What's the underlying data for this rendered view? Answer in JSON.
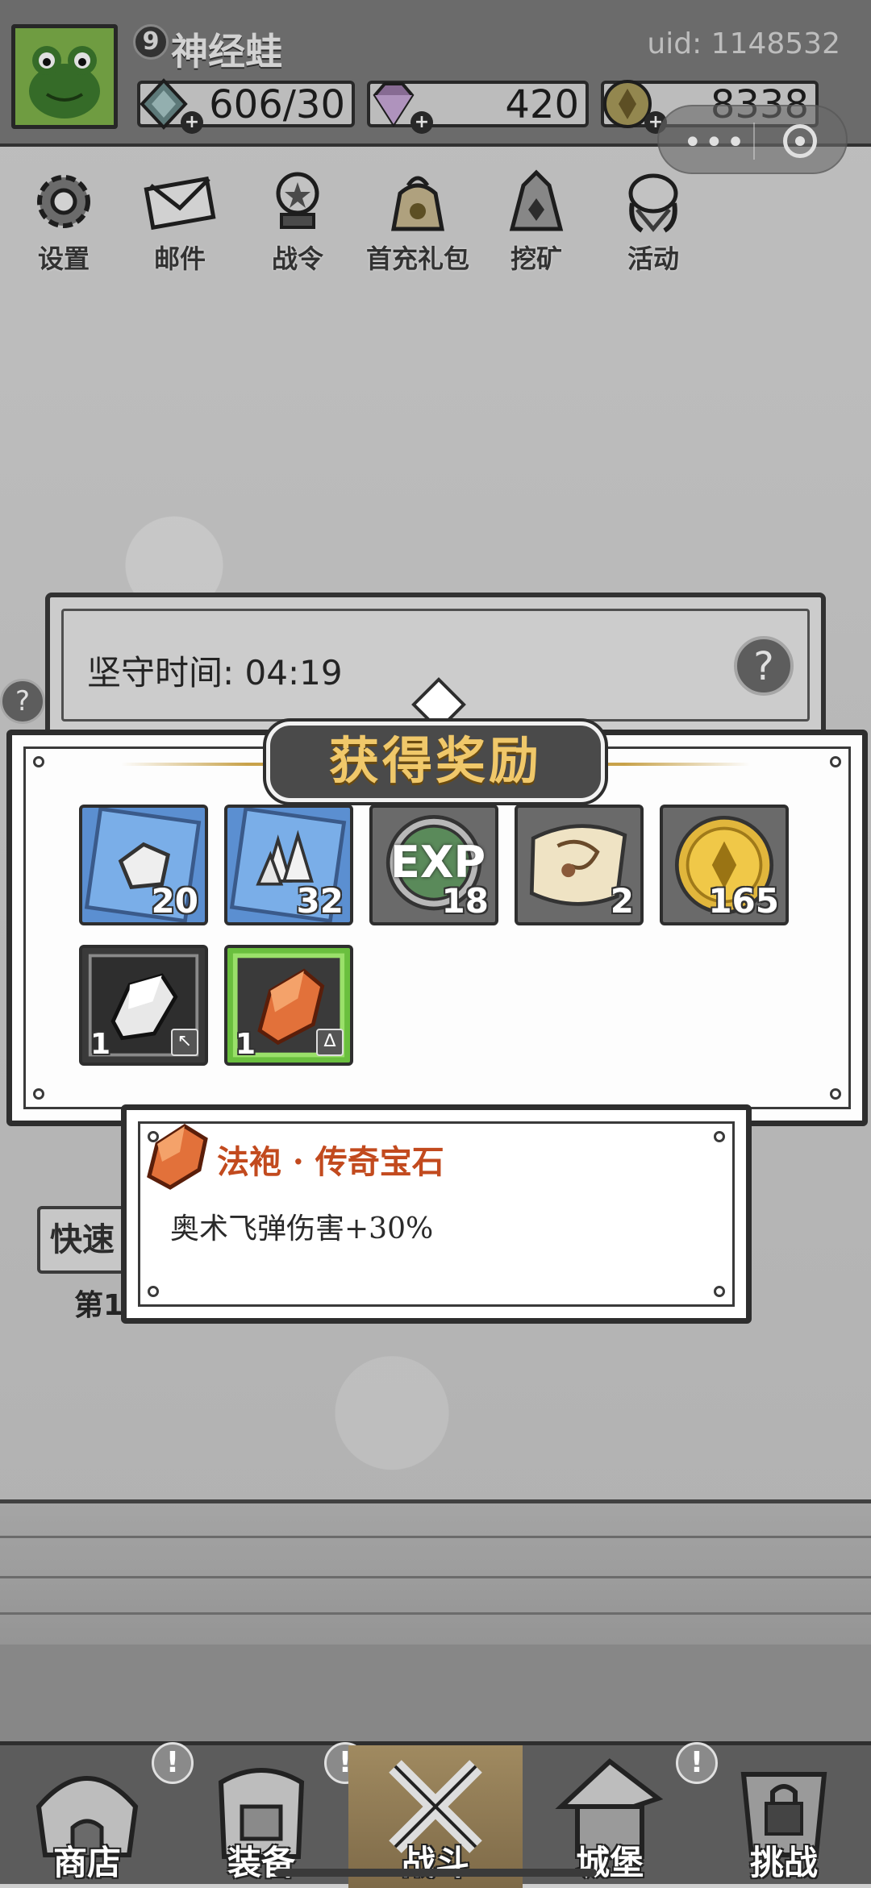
{
  "player": {
    "level": "9",
    "name": "神经蛙",
    "uid": "uid: 1148532"
  },
  "resources": {
    "stamina": "606/30",
    "diamonds": "420",
    "gold": "8338"
  },
  "menu": [
    {
      "label": "设置",
      "icon": "gear-icon"
    },
    {
      "label": "邮件",
      "icon": "mail-icon"
    },
    {
      "label": "战令",
      "icon": "battle-pass-icon"
    },
    {
      "label": "首充礼包",
      "icon": "gift-bag-icon"
    },
    {
      "label": "挖矿",
      "icon": "mining-icon"
    },
    {
      "label": "活动",
      "icon": "event-icon"
    }
  ],
  "defend": {
    "label": "坚守时间: 04:19",
    "help": "?"
  },
  "reward": {
    "title": "获得奖励",
    "items": [
      {
        "name": "iron-ore",
        "count": "20",
        "color": "#5b8fd1"
      },
      {
        "name": "crystal",
        "count": "32",
        "color": "#5b8fd1"
      },
      {
        "name": "exp",
        "count": "18",
        "label": "EXP"
      },
      {
        "name": "scroll",
        "count": "2"
      },
      {
        "name": "gold-coin",
        "count": "165"
      },
      {
        "name": "silver-gem",
        "count": "1"
      },
      {
        "name": "legendary-gem",
        "count": "1",
        "color": "#6abf3e"
      }
    ]
  },
  "tooltip": {
    "title": "法袍 · 传奇宝石",
    "desc": "奥术飞弹伤害+30%"
  },
  "background": {
    "quick_label": "快速",
    "stage_label": "第1"
  },
  "nav": [
    {
      "label": "商店",
      "alert": "!"
    },
    {
      "label": "装备",
      "alert": "!"
    },
    {
      "label": "战斗"
    },
    {
      "label": "城堡",
      "alert": "!"
    },
    {
      "label": "挑战"
    }
  ]
}
